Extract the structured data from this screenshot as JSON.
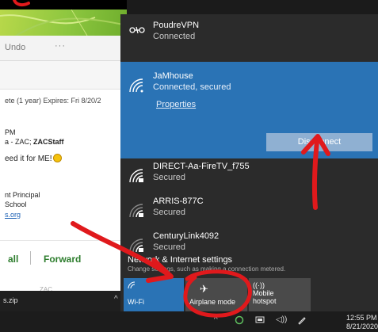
{
  "email": {
    "toolbar": {
      "undo": "Undo",
      "more": "···"
    },
    "retention": "ete (1 year) Expires: Fri 8/20/2",
    "time": "PM",
    "recipients_prefix": "a - ZAC; ",
    "recipients_bold": "ZACStaff",
    "body_line": "eed it for ME!",
    "sig_title": "nt Principal",
    "sig_school": "School",
    "sig_link": "s.org",
    "reply_all": "all",
    "forward": "Forward",
    "faded": "ZAC",
    "download_name": "s.zip",
    "download_chevron": "^"
  },
  "flyout": {
    "vpn": {
      "name": "PoudreVPN",
      "status": "Connected",
      "icon": "vpn-icon"
    },
    "active": {
      "name": "JaMhouse",
      "status": "Connected, secured",
      "properties": "Properties",
      "disconnect": "Disconnect",
      "icon": "wifi-icon"
    },
    "networks": [
      {
        "name": "DIRECT-Aa-FireTV_f755",
        "status": "Secured",
        "icon": "wifi-secured-icon"
      },
      {
        "name": "ARRIS-877C",
        "status": "Secured",
        "icon": "wifi-secured-icon"
      },
      {
        "name": "CenturyLink4092",
        "status": "Secured",
        "icon": "wifi-secured-icon"
      }
    ],
    "settings": {
      "title": "Network & Internet settings",
      "subtitle": "Change settings, such as making a connection metered."
    },
    "tiles": {
      "wifi": {
        "label": "Wi-Fi"
      },
      "airplane": {
        "label": "Airplane mode"
      },
      "hotspot": {
        "label_1": "Mobile",
        "label_2": "hotspot"
      }
    }
  },
  "taskbar": {
    "time": "12:55 PM",
    "date": "8/21/2020",
    "tray_chevron": "^"
  },
  "colors": {
    "accent": "#2a73b5",
    "flyout_bg": "#2b2b2b",
    "disconnect_btn": "#8fb0d2",
    "annotation": "#e0191c",
    "email_action": "#2d7d2d"
  }
}
